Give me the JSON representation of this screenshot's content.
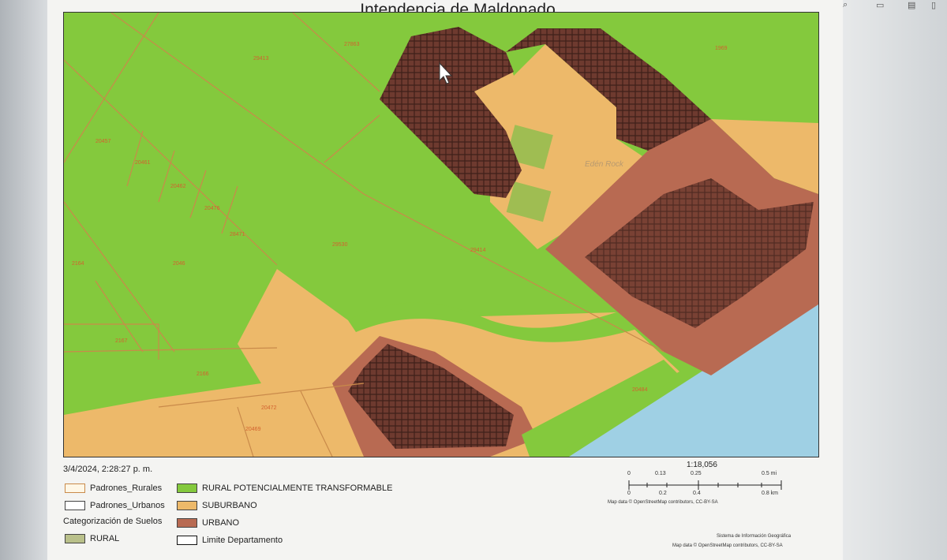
{
  "header": {
    "title": "Intendencia de Maldonado"
  },
  "map": {
    "place_label": "Edén Rock",
    "parcel_labels": [
      "27863",
      "29413",
      "1969",
      "20457",
      "20461",
      "20462",
      "20476",
      "28471",
      "29530",
      "29414",
      "2164",
      "2046",
      "2167",
      "2166",
      "20472",
      "20469",
      "20484"
    ],
    "cursor_icon": "arrow-cursor-icon",
    "colors": {
      "rural_potencialmente_transformable": "#84c93d",
      "suburbano": "#edb96a",
      "urbano": "#b86a52",
      "urbano_dense": "#6e3a2f",
      "water": "#9fd0e4",
      "parcel_line": "#c98a4a"
    }
  },
  "footer": {
    "timestamp": "3/4/2024, 2:28:27 p. m.",
    "scale_ratio": "1:18,056",
    "scale_top_ticks": [
      "0",
      "0.13",
      "0.25",
      "0.5 mi"
    ],
    "scale_bottom_ticks": [
      "0",
      "0.2",
      "0.4",
      "0.8 km"
    ],
    "attribution_1": "Map data © OpenStreetMap contributors, CC-BY-SA",
    "attribution_2": "Sistema de Información Geográfica",
    "attribution_3": "Map data © OpenStreetMap contributors, CC-BY-SA"
  },
  "legend": {
    "padrones_rurales": "Padrones_Rurales",
    "padrones_urbanos": "Padrones_Urbanos",
    "categorizacion": "Categorización de Suelos",
    "rural": "RURAL",
    "rural_pt": "RURAL POTENCIALMENTE TRANSFORMABLE",
    "suburbano": "SUBURBANO",
    "urbano": "URBANO",
    "limite": "Limite Departamento"
  }
}
